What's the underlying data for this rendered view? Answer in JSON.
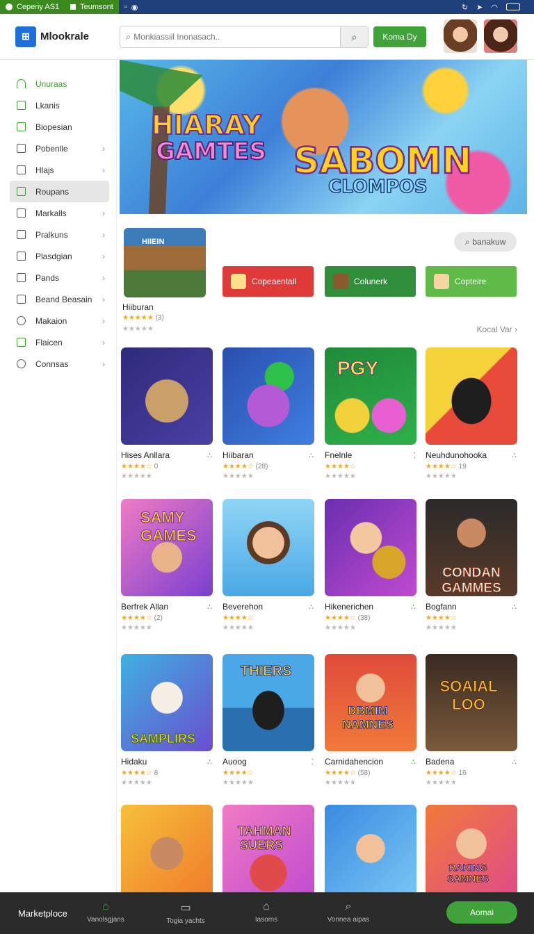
{
  "status_bar": {
    "left_label": "Ceperiy AS1",
    "tab_label": "Teumsont"
  },
  "header": {
    "logo_text": "Mlookrale",
    "search_placeholder": "Monkiassiil Inonasach..",
    "cta_label": "Koma Dy"
  },
  "sidebar": {
    "items": [
      {
        "label": "Unuraas",
        "icon": "wifi-icon",
        "style": "green"
      },
      {
        "label": "Lkanis",
        "icon": "home-icon"
      },
      {
        "label": "Biopesian",
        "icon": "box-icon",
        "style": "green-icon"
      },
      {
        "label": "Pobenlle",
        "icon": "square-icon",
        "chevron": "›"
      },
      {
        "label": "Hlajs",
        "icon": "grid-icon",
        "chevron": "›"
      },
      {
        "label": "Roupans",
        "icon": "square-icon",
        "style": "active"
      },
      {
        "label": "Markalls",
        "icon": "home-icon",
        "chevron": "›"
      },
      {
        "label": "Pralkuns",
        "icon": "square-icon",
        "chevron": "›"
      },
      {
        "label": "Plasdgian",
        "icon": "doc-icon",
        "chevron": "›"
      },
      {
        "label": "Pands",
        "icon": "edit-icon",
        "chevron": "›"
      },
      {
        "label": "Beand Beasain",
        "icon": "doc-icon",
        "chevron": "›"
      },
      {
        "label": "Makaion",
        "icon": "circle-icon",
        "chevron": "›"
      },
      {
        "label": "Flaicen",
        "icon": "box-icon",
        "style": "green-icon",
        "chevron": "›"
      },
      {
        "label": "Connsas",
        "icon": "circle-icon",
        "chevron": "›"
      }
    ]
  },
  "banner": {
    "title_line1": "HIARAY",
    "title_line2": "GAMTES",
    "title_main": "SABOMN",
    "subtitle": "CLOMPOS"
  },
  "featured": {
    "title": "Hiiburan",
    "rating_count": "(3)",
    "thumb_label": "HIIEIN"
  },
  "filter_pill": "banakuw",
  "categories": [
    {
      "label": "Copeaentall",
      "color": "#e13a3a"
    },
    {
      "label": "Colunerk",
      "color": "#2f8f3a"
    },
    {
      "label": "Copteire",
      "color": "#5fba47"
    }
  ],
  "see_all": "Kocal Var",
  "grid": [
    {
      "title": "Hises Anllara",
      "count": "0",
      "dots": "∴"
    },
    {
      "title": "Hiibaran",
      "count": "(28)",
      "dots": "∴"
    },
    {
      "title": "Fnelnle",
      "count": "",
      "dots": "⁚"
    },
    {
      "title": "Neuhdunohooka",
      "count": "19",
      "dots": "∴"
    },
    {
      "title": "Berfrek Allan",
      "count": "(2)",
      "dots": "∴"
    },
    {
      "title": "Beverehon",
      "count": "",
      "dots": "∴"
    },
    {
      "title": "Hikenerichen",
      "count": "(38)",
      "dots": "∴"
    },
    {
      "title": "Bogfann",
      "count": "",
      "dots": "∴"
    },
    {
      "title": "Hidaku",
      "count": "8",
      "dots": "∴"
    },
    {
      "title": "Auoog",
      "count": "",
      "dots": "⁚"
    },
    {
      "title": "Carnidahencion",
      "count": "(58)",
      "dots": "∴"
    },
    {
      "title": "Badena",
      "count": "16",
      "dots": "∴"
    },
    {
      "title": "",
      "count": "",
      "dots": ""
    },
    {
      "title": "",
      "count": "",
      "dots": ""
    },
    {
      "title": "",
      "count": "",
      "dots": ""
    },
    {
      "title": "",
      "count": "",
      "dots": ""
    }
  ],
  "thumb_text": [
    "",
    "",
    "PGY",
    "",
    "SAMY GAMES",
    "",
    "",
    "CONDAN GAMMES",
    "SAMPLIRS",
    "THIERS",
    "DBMIM NAMNES",
    "SOAIAL LOO",
    "",
    "TAHMAN SUERS",
    "",
    "RAKING SAMNES"
  ],
  "bottom_bar": {
    "brand": "Marketploce",
    "nav": [
      {
        "label": "Vanolsgjans",
        "icon": "home-icon"
      },
      {
        "label": "Togia yachts",
        "icon": "book-icon"
      },
      {
        "label": "Iasoms",
        "icon": "bank-icon"
      },
      {
        "label": "Vonnea aipas",
        "icon": "user-search-icon"
      }
    ],
    "cta_label": "Aomai"
  }
}
